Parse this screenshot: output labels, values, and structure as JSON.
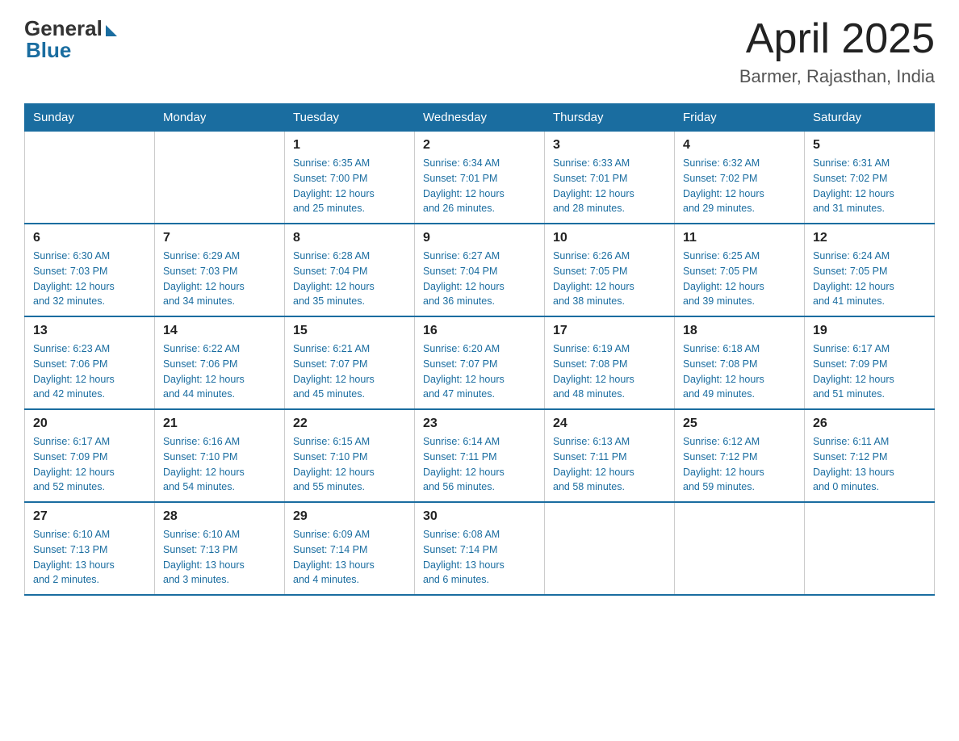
{
  "header": {
    "logo_general": "General",
    "logo_blue": "Blue",
    "month_title": "April 2025",
    "location": "Barmer, Rajasthan, India"
  },
  "weekdays": [
    "Sunday",
    "Monday",
    "Tuesday",
    "Wednesday",
    "Thursday",
    "Friday",
    "Saturday"
  ],
  "weeks": [
    [
      {
        "day": "",
        "info": ""
      },
      {
        "day": "",
        "info": ""
      },
      {
        "day": "1",
        "info": "Sunrise: 6:35 AM\nSunset: 7:00 PM\nDaylight: 12 hours\nand 25 minutes."
      },
      {
        "day": "2",
        "info": "Sunrise: 6:34 AM\nSunset: 7:01 PM\nDaylight: 12 hours\nand 26 minutes."
      },
      {
        "day": "3",
        "info": "Sunrise: 6:33 AM\nSunset: 7:01 PM\nDaylight: 12 hours\nand 28 minutes."
      },
      {
        "day": "4",
        "info": "Sunrise: 6:32 AM\nSunset: 7:02 PM\nDaylight: 12 hours\nand 29 minutes."
      },
      {
        "day": "5",
        "info": "Sunrise: 6:31 AM\nSunset: 7:02 PM\nDaylight: 12 hours\nand 31 minutes."
      }
    ],
    [
      {
        "day": "6",
        "info": "Sunrise: 6:30 AM\nSunset: 7:03 PM\nDaylight: 12 hours\nand 32 minutes."
      },
      {
        "day": "7",
        "info": "Sunrise: 6:29 AM\nSunset: 7:03 PM\nDaylight: 12 hours\nand 34 minutes."
      },
      {
        "day": "8",
        "info": "Sunrise: 6:28 AM\nSunset: 7:04 PM\nDaylight: 12 hours\nand 35 minutes."
      },
      {
        "day": "9",
        "info": "Sunrise: 6:27 AM\nSunset: 7:04 PM\nDaylight: 12 hours\nand 36 minutes."
      },
      {
        "day": "10",
        "info": "Sunrise: 6:26 AM\nSunset: 7:05 PM\nDaylight: 12 hours\nand 38 minutes."
      },
      {
        "day": "11",
        "info": "Sunrise: 6:25 AM\nSunset: 7:05 PM\nDaylight: 12 hours\nand 39 minutes."
      },
      {
        "day": "12",
        "info": "Sunrise: 6:24 AM\nSunset: 7:05 PM\nDaylight: 12 hours\nand 41 minutes."
      }
    ],
    [
      {
        "day": "13",
        "info": "Sunrise: 6:23 AM\nSunset: 7:06 PM\nDaylight: 12 hours\nand 42 minutes."
      },
      {
        "day": "14",
        "info": "Sunrise: 6:22 AM\nSunset: 7:06 PM\nDaylight: 12 hours\nand 44 minutes."
      },
      {
        "day": "15",
        "info": "Sunrise: 6:21 AM\nSunset: 7:07 PM\nDaylight: 12 hours\nand 45 minutes."
      },
      {
        "day": "16",
        "info": "Sunrise: 6:20 AM\nSunset: 7:07 PM\nDaylight: 12 hours\nand 47 minutes."
      },
      {
        "day": "17",
        "info": "Sunrise: 6:19 AM\nSunset: 7:08 PM\nDaylight: 12 hours\nand 48 minutes."
      },
      {
        "day": "18",
        "info": "Sunrise: 6:18 AM\nSunset: 7:08 PM\nDaylight: 12 hours\nand 49 minutes."
      },
      {
        "day": "19",
        "info": "Sunrise: 6:17 AM\nSunset: 7:09 PM\nDaylight: 12 hours\nand 51 minutes."
      }
    ],
    [
      {
        "day": "20",
        "info": "Sunrise: 6:17 AM\nSunset: 7:09 PM\nDaylight: 12 hours\nand 52 minutes."
      },
      {
        "day": "21",
        "info": "Sunrise: 6:16 AM\nSunset: 7:10 PM\nDaylight: 12 hours\nand 54 minutes."
      },
      {
        "day": "22",
        "info": "Sunrise: 6:15 AM\nSunset: 7:10 PM\nDaylight: 12 hours\nand 55 minutes."
      },
      {
        "day": "23",
        "info": "Sunrise: 6:14 AM\nSunset: 7:11 PM\nDaylight: 12 hours\nand 56 minutes."
      },
      {
        "day": "24",
        "info": "Sunrise: 6:13 AM\nSunset: 7:11 PM\nDaylight: 12 hours\nand 58 minutes."
      },
      {
        "day": "25",
        "info": "Sunrise: 6:12 AM\nSunset: 7:12 PM\nDaylight: 12 hours\nand 59 minutes."
      },
      {
        "day": "26",
        "info": "Sunrise: 6:11 AM\nSunset: 7:12 PM\nDaylight: 13 hours\nand 0 minutes."
      }
    ],
    [
      {
        "day": "27",
        "info": "Sunrise: 6:10 AM\nSunset: 7:13 PM\nDaylight: 13 hours\nand 2 minutes."
      },
      {
        "day": "28",
        "info": "Sunrise: 6:10 AM\nSunset: 7:13 PM\nDaylight: 13 hours\nand 3 minutes."
      },
      {
        "day": "29",
        "info": "Sunrise: 6:09 AM\nSunset: 7:14 PM\nDaylight: 13 hours\nand 4 minutes."
      },
      {
        "day": "30",
        "info": "Sunrise: 6:08 AM\nSunset: 7:14 PM\nDaylight: 13 hours\nand 6 minutes."
      },
      {
        "day": "",
        "info": ""
      },
      {
        "day": "",
        "info": ""
      },
      {
        "day": "",
        "info": ""
      }
    ]
  ]
}
